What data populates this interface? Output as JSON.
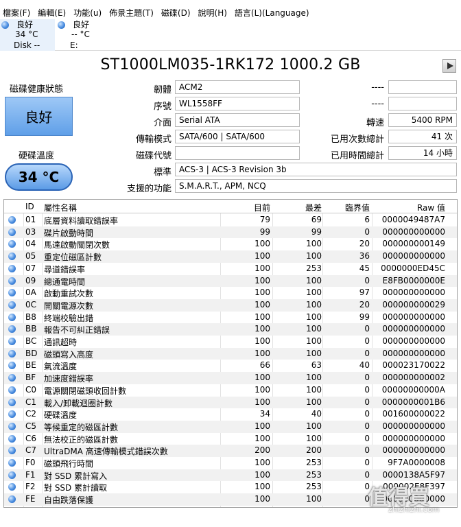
{
  "menu": [
    "檔案(F)",
    "編輯(E)",
    "功能(u)",
    "佈景主題(T)",
    "磁碟(D)",
    "說明(H)",
    "語言(L)(Language)"
  ],
  "disks": [
    {
      "status": "良好",
      "temp": "34 °C",
      "name": "Disk --"
    },
    {
      "status": "良好",
      "temp": "-- °C",
      "name": "E:"
    }
  ],
  "model": "ST1000LM035-1RK172 1000.2 GB",
  "health": {
    "label": "磁碟健康狀態",
    "value": "良好"
  },
  "temperature": {
    "label": "硬碟溫度",
    "value": "34 °C"
  },
  "info": {
    "firmware": {
      "label": "韌體",
      "value": "ACM2"
    },
    "serial": {
      "label": "序號",
      "value": "WL1558FF"
    },
    "interface": {
      "label": "介面",
      "value": "Serial ATA"
    },
    "transfer": {
      "label": "傳輸模式",
      "value": "SATA/600 | SATA/600"
    },
    "drive_letter": {
      "label": "磁碟代號",
      "value": ""
    },
    "standard": {
      "label": "標準",
      "value": "ACS-3 | ACS-3 Revision 3b"
    },
    "features": {
      "label": "支援的功能",
      "value": "S.M.A.R.T., APM, NCQ"
    },
    "r1": {
      "label": "----",
      "value": ""
    },
    "r2": {
      "label": "----",
      "value": ""
    },
    "rotation": {
      "label": "轉速",
      "value": "5400 RPM"
    },
    "power_count": {
      "label": "已用次數總計",
      "value": "41 次"
    },
    "power_hours": {
      "label": "已用時間總計",
      "value": "14 小時"
    }
  },
  "table": {
    "headers": {
      "id": "ID",
      "name": "屬性名稱",
      "current": "目前",
      "worst": "最差",
      "threshold": "臨界值",
      "raw": "Raw 值"
    },
    "rows": [
      {
        "id": "01",
        "name": "底層資料讀取錯誤率",
        "cur": "79",
        "worst": "69",
        "thr": "6",
        "raw": "0000049487A7"
      },
      {
        "id": "03",
        "name": "碟片啟動時間",
        "cur": "99",
        "worst": "99",
        "thr": "0",
        "raw": "000000000000"
      },
      {
        "id": "04",
        "name": "馬達啟動關閉次數",
        "cur": "100",
        "worst": "100",
        "thr": "20",
        "raw": "000000000149"
      },
      {
        "id": "05",
        "name": "重定位磁區計數",
        "cur": "100",
        "worst": "100",
        "thr": "36",
        "raw": "000000000000"
      },
      {
        "id": "07",
        "name": "尋道錯誤率",
        "cur": "100",
        "worst": "253",
        "thr": "45",
        "raw": "0000000ED45C"
      },
      {
        "id": "09",
        "name": "總通電時間",
        "cur": "100",
        "worst": "100",
        "thr": "0",
        "raw": "E8FB0000000E"
      },
      {
        "id": "0A",
        "name": "啟動重試次數",
        "cur": "100",
        "worst": "100",
        "thr": "97",
        "raw": "000000000000"
      },
      {
        "id": "0C",
        "name": "開關電源次數",
        "cur": "100",
        "worst": "100",
        "thr": "20",
        "raw": "000000000029"
      },
      {
        "id": "B8",
        "name": "終端校驗出錯",
        "cur": "100",
        "worst": "100",
        "thr": "99",
        "raw": "000000000000"
      },
      {
        "id": "BB",
        "name": "報告不可糾正錯誤",
        "cur": "100",
        "worst": "100",
        "thr": "0",
        "raw": "000000000000"
      },
      {
        "id": "BC",
        "name": "通訊超時",
        "cur": "100",
        "worst": "100",
        "thr": "0",
        "raw": "000000000000"
      },
      {
        "id": "BD",
        "name": "磁頭寫入高度",
        "cur": "100",
        "worst": "100",
        "thr": "0",
        "raw": "000000000000"
      },
      {
        "id": "BE",
        "name": "氣流溫度",
        "cur": "66",
        "worst": "63",
        "thr": "40",
        "raw": "000023170022"
      },
      {
        "id": "BF",
        "name": "加速度錯誤率",
        "cur": "100",
        "worst": "100",
        "thr": "0",
        "raw": "000000000002"
      },
      {
        "id": "C0",
        "name": "電源關閉磁頭收回計數",
        "cur": "100",
        "worst": "100",
        "thr": "0",
        "raw": "00000000000A"
      },
      {
        "id": "C1",
        "name": "載入/卸載迴圈計數",
        "cur": "100",
        "worst": "100",
        "thr": "0",
        "raw": "0000000001B6"
      },
      {
        "id": "C2",
        "name": "硬碟溫度",
        "cur": "34",
        "worst": "40",
        "thr": "0",
        "raw": "001600000022"
      },
      {
        "id": "C5",
        "name": "等候重定的磁區計數",
        "cur": "100",
        "worst": "100",
        "thr": "0",
        "raw": "000000000000"
      },
      {
        "id": "C6",
        "name": "無法校正的磁區計數",
        "cur": "100",
        "worst": "100",
        "thr": "0",
        "raw": "000000000000"
      },
      {
        "id": "C7",
        "name": "UltraDMA 高速傳輸模式錯誤次數",
        "cur": "200",
        "worst": "200",
        "thr": "0",
        "raw": "000000000000"
      },
      {
        "id": "F0",
        "name": "磁頭飛行時間",
        "cur": "100",
        "worst": "253",
        "thr": "0",
        "raw": "9F7A0000008"
      },
      {
        "id": "F1",
        "name": "對 SSD 累計寫入",
        "cur": "100",
        "worst": "253",
        "thr": "0",
        "raw": "0000138A5F97"
      },
      {
        "id": "F2",
        "name": "對 SSD 累計讀取",
        "cur": "100",
        "worst": "253",
        "thr": "0",
        "raw": "000002E8F397"
      },
      {
        "id": "FE",
        "name": "自由跌落保護",
        "cur": "100",
        "worst": "100",
        "thr": "0",
        "raw": "000000000000"
      }
    ]
  },
  "watermark": {
    "main": "值得買",
    "sub": "zhizhizhi.com"
  },
  "colors": {
    "accent": "#5f9fe8",
    "status_good": "#4a8de0"
  }
}
